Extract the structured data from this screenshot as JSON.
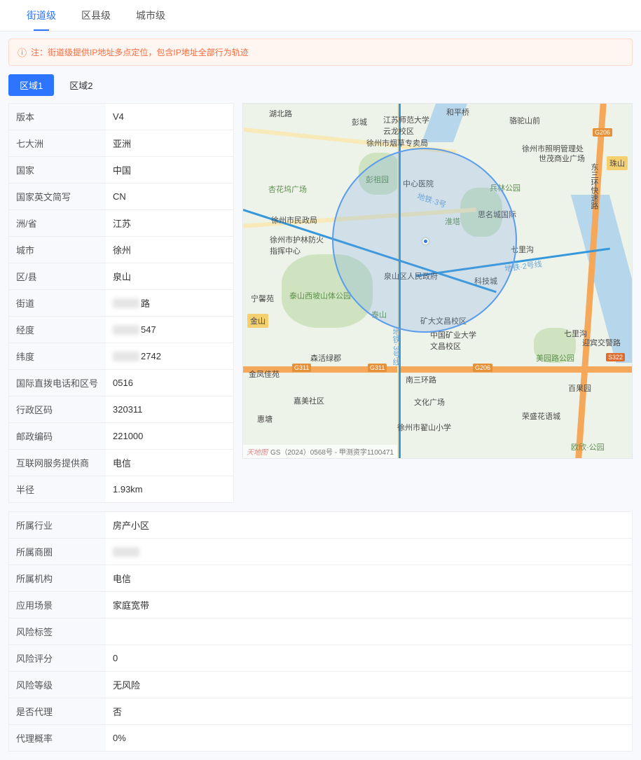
{
  "tabs": {
    "street": "街道级",
    "district": "区县级",
    "city": "城市级"
  },
  "notice": {
    "prefix": "注：",
    "text": "街道级提供IP地址多点定位，包含IP地址全部行为轨迹"
  },
  "areaTabs": {
    "a1": "区域1",
    "a2": "区域2"
  },
  "info": {
    "version": {
      "label": "版本",
      "value": "V4"
    },
    "continent": {
      "label": "七大洲",
      "value": "亚洲"
    },
    "country": {
      "label": "国家",
      "value": "中国"
    },
    "countryEn": {
      "label": "国家英文简写",
      "value": "CN"
    },
    "province": {
      "label": "洲/省",
      "value": "江苏"
    },
    "city": {
      "label": "城市",
      "value": "徐州"
    },
    "county": {
      "label": "区/县",
      "value": "泉山"
    },
    "street": {
      "label": "街道",
      "value": "路"
    },
    "lng": {
      "label": "经度",
      "value": "547"
    },
    "lat": {
      "label": "纬度",
      "value": "2742"
    },
    "idd": {
      "label": "国际直拨电话和区号",
      "value": "0516"
    },
    "admin": {
      "label": "行政区码",
      "value": "320311"
    },
    "zip": {
      "label": "邮政编码",
      "value": "221000"
    },
    "isp": {
      "label": "互联网服务提供商",
      "value": "电信"
    },
    "radius": {
      "label": "半径",
      "value": "1.93km"
    }
  },
  "lower": {
    "industry": {
      "label": "所属行业",
      "value": "房产小区"
    },
    "bizArea": {
      "label": "所属商圈",
      "value": ""
    },
    "org": {
      "label": "所属机构",
      "value": "电信"
    },
    "scene": {
      "label": "应用场景",
      "value": "家庭宽带"
    },
    "riskTag": {
      "label": "风险标签",
      "value": ""
    },
    "riskScore": {
      "label": "风险评分",
      "value": "0"
    },
    "riskLevel": {
      "label": "风险等级",
      "value": "无风险"
    },
    "proxy": {
      "label": "是否代理",
      "value": "否"
    },
    "proxyRate": {
      "label": "代理概率",
      "value": "0%"
    }
  },
  "map": {
    "attrib_wm": "天地图",
    "attrib": "GS（2024）0568号 - 甲测资字1100471",
    "pois": {
      "hubei": "湖北路",
      "pengcheng": "彭城",
      "jsnu": "江苏师范大学\n云龙校区",
      "hpq": "和平桥",
      "ltsq": "骆驼山前",
      "xzyc": "徐州市烟草专卖局",
      "xzzm": "徐州市照明管理处",
      "smsy": "世茂商业广场",
      "xhgc": "杏花坞广场",
      "xtgy": "彭祖园",
      "zxyy": "中心医院",
      "3hx": "东三环快速路",
      "blgy": "兵林公园",
      "xzmz": "徐州市民政局",
      "lmcl": "思名城国际",
      "ht": "淮塔",
      "xlfh": "徐州市护林防火\n指挥中心",
      "qlg": "七里沟",
      "nxw": "宁馨苑",
      "ts": "泰山",
      "txgy": "泰山西坡山体公园",
      "qsqz": "泉山区人民政府",
      "kjc": "科技城",
      "ql2": "七里沟",
      "ykcj": "迎宾交警路",
      "sjlq": "森活绿郡",
      "kd": "矿大文昌校区",
      "kdwc": "中国矿业大学\n文昌校区",
      "mylg": "美园路公园",
      "bgy": "百果园",
      "jfja": "金凤佳苑",
      "nsh": "南三环路",
      "jmsq": "嘉美社区",
      "htt": "惠塘",
      "stgc": "文化广场",
      "rsht": "荣盛花语城",
      "qsxx": "徐州市翟山小学",
      "oxgy": "欧欣·公园",
      "mt3a": "地铁·3号",
      "mt3b": "地铁·3号线",
      "mt2": "地铁·2号线",
      "sh206a": "G206",
      "sh206b": "G206",
      "sh311a": "G311",
      "sh311b": "G311",
      "sh322": "S322",
      "jsg": "金山",
      "zsg": "珠山"
    }
  }
}
